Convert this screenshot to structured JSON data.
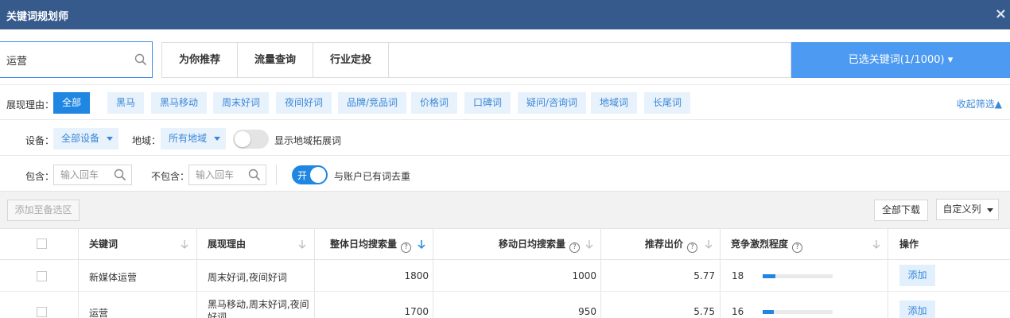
{
  "window": {
    "title": "关键词规划师",
    "close_glyph": "×"
  },
  "search": {
    "value": "运营"
  },
  "tabs": [
    {
      "label": "为你推荐"
    },
    {
      "label": "流量查询"
    },
    {
      "label": "行业定投"
    }
  ],
  "selected_keywords": {
    "label": "已选关键词(1/1000)",
    "caret": "▾"
  },
  "filters": {
    "reason_label": "展现理由：",
    "reasons": [
      "全部",
      "黑马",
      "黑马移动",
      "周末好词",
      "夜间好词",
      "品牌/竞品词",
      "价格词",
      "口碑词",
      "疑问/咨询词",
      "地域词",
      "长尾词"
    ],
    "active_reason": "全部",
    "collapse": "收起筛选▲",
    "device_label": "设备：",
    "device_value": "全部设备",
    "region_label": "地域：",
    "region_value": "所有地域",
    "region_expand_label": "显示地域拓展词",
    "region_expand_on": false,
    "include_label": "包含：",
    "include_placeholder": "输入回车",
    "exclude_label": "不包含：",
    "exclude_placeholder": "输入回车",
    "dedupe_toggle_text": "开",
    "dedupe_label": "与账户已有词去重",
    "dedupe_on": true
  },
  "toolbar": {
    "add_to_pool": "添加至备选区",
    "download_all": "全部下载",
    "custom_columns": "自定义列"
  },
  "table": {
    "headers": {
      "keyword": "关键词",
      "reason": "展现理由",
      "total_search": "整体日均搜索量",
      "mobile_search": "移动日均搜索量",
      "bid": "推荐出价",
      "competition": "竞争激烈程度",
      "action": "操作"
    },
    "help_glyph": "?",
    "rows": [
      {
        "keyword": "新媒体运营",
        "reason": "周末好词,夜间好词",
        "total": "1800",
        "mobile": "1000",
        "bid": "5.77",
        "competition": "18",
        "competition_level": 0.18,
        "action": "添加"
      },
      {
        "keyword": "运营",
        "reason": "黑马移动,周末好词,夜间好词",
        "total": "1700",
        "mobile": "950",
        "bid": "5.75",
        "competition": "16",
        "competition_level": 0.16,
        "action": "添加"
      }
    ]
  },
  "colors": {
    "titlebar": "#365a8c",
    "accent": "#1f86e2",
    "selected_panel": "#4c9af2",
    "chip_bg": "#e8f2fc"
  }
}
